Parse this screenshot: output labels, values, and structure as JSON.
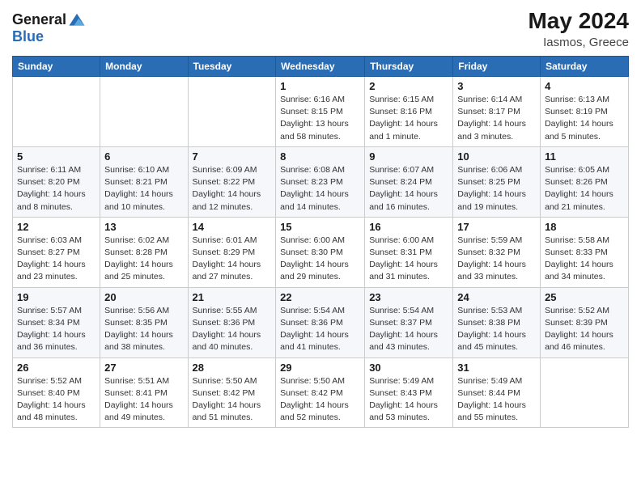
{
  "logo": {
    "text_general": "General",
    "text_blue": "Blue"
  },
  "header": {
    "month": "May 2024",
    "location": "Iasmos, Greece"
  },
  "weekdays": [
    "Sunday",
    "Monday",
    "Tuesday",
    "Wednesday",
    "Thursday",
    "Friday",
    "Saturday"
  ],
  "weeks": [
    [
      {
        "day": "",
        "sunrise": "",
        "sunset": "",
        "daylight": ""
      },
      {
        "day": "",
        "sunrise": "",
        "sunset": "",
        "daylight": ""
      },
      {
        "day": "",
        "sunrise": "",
        "sunset": "",
        "daylight": ""
      },
      {
        "day": "1",
        "sunrise": "Sunrise: 6:16 AM",
        "sunset": "Sunset: 8:15 PM",
        "daylight": "Daylight: 13 hours and 58 minutes."
      },
      {
        "day": "2",
        "sunrise": "Sunrise: 6:15 AM",
        "sunset": "Sunset: 8:16 PM",
        "daylight": "Daylight: 14 hours and 1 minute."
      },
      {
        "day": "3",
        "sunrise": "Sunrise: 6:14 AM",
        "sunset": "Sunset: 8:17 PM",
        "daylight": "Daylight: 14 hours and 3 minutes."
      },
      {
        "day": "4",
        "sunrise": "Sunrise: 6:13 AM",
        "sunset": "Sunset: 8:19 PM",
        "daylight": "Daylight: 14 hours and 5 minutes."
      }
    ],
    [
      {
        "day": "5",
        "sunrise": "Sunrise: 6:11 AM",
        "sunset": "Sunset: 8:20 PM",
        "daylight": "Daylight: 14 hours and 8 minutes."
      },
      {
        "day": "6",
        "sunrise": "Sunrise: 6:10 AM",
        "sunset": "Sunset: 8:21 PM",
        "daylight": "Daylight: 14 hours and 10 minutes."
      },
      {
        "day": "7",
        "sunrise": "Sunrise: 6:09 AM",
        "sunset": "Sunset: 8:22 PM",
        "daylight": "Daylight: 14 hours and 12 minutes."
      },
      {
        "day": "8",
        "sunrise": "Sunrise: 6:08 AM",
        "sunset": "Sunset: 8:23 PM",
        "daylight": "Daylight: 14 hours and 14 minutes."
      },
      {
        "day": "9",
        "sunrise": "Sunrise: 6:07 AM",
        "sunset": "Sunset: 8:24 PM",
        "daylight": "Daylight: 14 hours and 16 minutes."
      },
      {
        "day": "10",
        "sunrise": "Sunrise: 6:06 AM",
        "sunset": "Sunset: 8:25 PM",
        "daylight": "Daylight: 14 hours and 19 minutes."
      },
      {
        "day": "11",
        "sunrise": "Sunrise: 6:05 AM",
        "sunset": "Sunset: 8:26 PM",
        "daylight": "Daylight: 14 hours and 21 minutes."
      }
    ],
    [
      {
        "day": "12",
        "sunrise": "Sunrise: 6:03 AM",
        "sunset": "Sunset: 8:27 PM",
        "daylight": "Daylight: 14 hours and 23 minutes."
      },
      {
        "day": "13",
        "sunrise": "Sunrise: 6:02 AM",
        "sunset": "Sunset: 8:28 PM",
        "daylight": "Daylight: 14 hours and 25 minutes."
      },
      {
        "day": "14",
        "sunrise": "Sunrise: 6:01 AM",
        "sunset": "Sunset: 8:29 PM",
        "daylight": "Daylight: 14 hours and 27 minutes."
      },
      {
        "day": "15",
        "sunrise": "Sunrise: 6:00 AM",
        "sunset": "Sunset: 8:30 PM",
        "daylight": "Daylight: 14 hours and 29 minutes."
      },
      {
        "day": "16",
        "sunrise": "Sunrise: 6:00 AM",
        "sunset": "Sunset: 8:31 PM",
        "daylight": "Daylight: 14 hours and 31 minutes."
      },
      {
        "day": "17",
        "sunrise": "Sunrise: 5:59 AM",
        "sunset": "Sunset: 8:32 PM",
        "daylight": "Daylight: 14 hours and 33 minutes."
      },
      {
        "day": "18",
        "sunrise": "Sunrise: 5:58 AM",
        "sunset": "Sunset: 8:33 PM",
        "daylight": "Daylight: 14 hours and 34 minutes."
      }
    ],
    [
      {
        "day": "19",
        "sunrise": "Sunrise: 5:57 AM",
        "sunset": "Sunset: 8:34 PM",
        "daylight": "Daylight: 14 hours and 36 minutes."
      },
      {
        "day": "20",
        "sunrise": "Sunrise: 5:56 AM",
        "sunset": "Sunset: 8:35 PM",
        "daylight": "Daylight: 14 hours and 38 minutes."
      },
      {
        "day": "21",
        "sunrise": "Sunrise: 5:55 AM",
        "sunset": "Sunset: 8:36 PM",
        "daylight": "Daylight: 14 hours and 40 minutes."
      },
      {
        "day": "22",
        "sunrise": "Sunrise: 5:54 AM",
        "sunset": "Sunset: 8:36 PM",
        "daylight": "Daylight: 14 hours and 41 minutes."
      },
      {
        "day": "23",
        "sunrise": "Sunrise: 5:54 AM",
        "sunset": "Sunset: 8:37 PM",
        "daylight": "Daylight: 14 hours and 43 minutes."
      },
      {
        "day": "24",
        "sunrise": "Sunrise: 5:53 AM",
        "sunset": "Sunset: 8:38 PM",
        "daylight": "Daylight: 14 hours and 45 minutes."
      },
      {
        "day": "25",
        "sunrise": "Sunrise: 5:52 AM",
        "sunset": "Sunset: 8:39 PM",
        "daylight": "Daylight: 14 hours and 46 minutes."
      }
    ],
    [
      {
        "day": "26",
        "sunrise": "Sunrise: 5:52 AM",
        "sunset": "Sunset: 8:40 PM",
        "daylight": "Daylight: 14 hours and 48 minutes."
      },
      {
        "day": "27",
        "sunrise": "Sunrise: 5:51 AM",
        "sunset": "Sunset: 8:41 PM",
        "daylight": "Daylight: 14 hours and 49 minutes."
      },
      {
        "day": "28",
        "sunrise": "Sunrise: 5:50 AM",
        "sunset": "Sunset: 8:42 PM",
        "daylight": "Daylight: 14 hours and 51 minutes."
      },
      {
        "day": "29",
        "sunrise": "Sunrise: 5:50 AM",
        "sunset": "Sunset: 8:42 PM",
        "daylight": "Daylight: 14 hours and 52 minutes."
      },
      {
        "day": "30",
        "sunrise": "Sunrise: 5:49 AM",
        "sunset": "Sunset: 8:43 PM",
        "daylight": "Daylight: 14 hours and 53 minutes."
      },
      {
        "day": "31",
        "sunrise": "Sunrise: 5:49 AM",
        "sunset": "Sunset: 8:44 PM",
        "daylight": "Daylight: 14 hours and 55 minutes."
      },
      {
        "day": "",
        "sunrise": "",
        "sunset": "",
        "daylight": ""
      }
    ]
  ]
}
